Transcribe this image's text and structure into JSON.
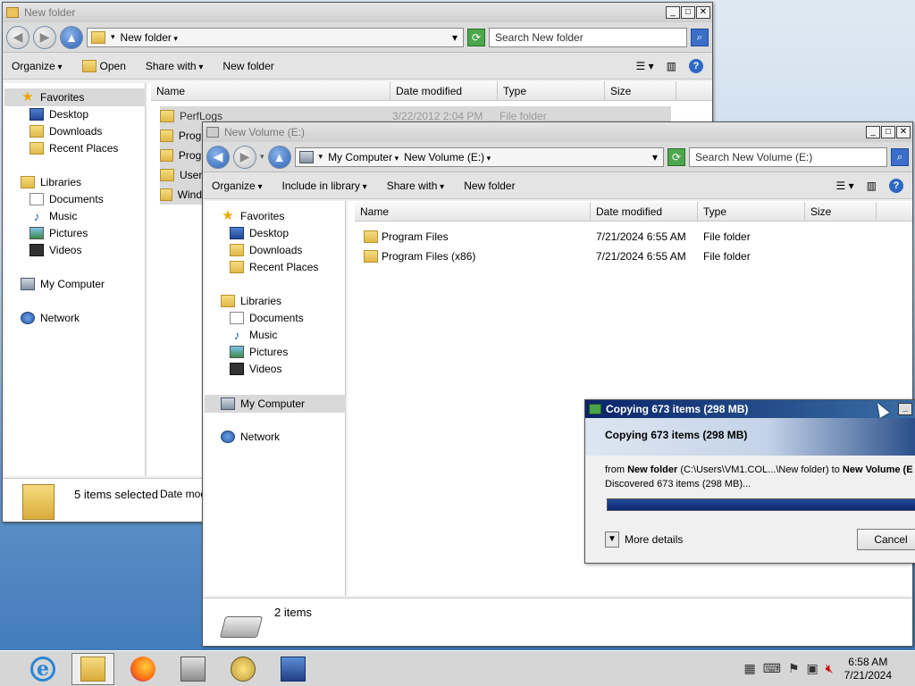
{
  "back_window": {
    "title": "New folder",
    "address": [
      "New folder"
    ],
    "search_placeholder": "Search New folder",
    "toolbar": {
      "organize": "Organize",
      "open": "Open",
      "share_with": "Share with",
      "new_folder": "New folder"
    },
    "nav": {
      "favorites": "Favorites",
      "desktop": "Desktop",
      "downloads": "Downloads",
      "recent": "Recent Places",
      "libraries": "Libraries",
      "documents": "Documents",
      "music": "Music",
      "pictures": "Pictures",
      "videos": "Videos",
      "computer": "My Computer",
      "network": "Network"
    },
    "columns": {
      "name": "Name",
      "date": "Date modified",
      "type": "Type",
      "size": "Size"
    },
    "rows": [
      {
        "name": "PerfLogs",
        "date": "3/22/2012 2:04 PM",
        "type": "File folder"
      },
      {
        "name": "Progr"
      },
      {
        "name": "Progr"
      },
      {
        "name": "User"
      },
      {
        "name": "Windo"
      }
    ],
    "status": {
      "selected": "5 items selected",
      "date": "Date mod"
    }
  },
  "front_window": {
    "title": "New Volume (E:)",
    "address": [
      "My Computer",
      "New Volume (E:)"
    ],
    "search_placeholder": "Search New Volume (E:)",
    "toolbar": {
      "organize": "Organize",
      "include": "Include in library",
      "share_with": "Share with",
      "new_folder": "New folder"
    },
    "nav": {
      "favorites": "Favorites",
      "desktop": "Desktop",
      "downloads": "Downloads",
      "recent": "Recent Places",
      "libraries": "Libraries",
      "documents": "Documents",
      "music": "Music",
      "pictures": "Pictures",
      "videos": "Videos",
      "computer": "My Computer",
      "network": "Network"
    },
    "columns": {
      "name": "Name",
      "date": "Date modified",
      "type": "Type",
      "size": "Size"
    },
    "rows": [
      {
        "name": "Program Files",
        "date": "7/21/2024 6:55 AM",
        "type": "File folder"
      },
      {
        "name": "Program Files (x86)",
        "date": "7/21/2024 6:55 AM",
        "type": "File folder"
      }
    ],
    "status": {
      "count": "2 items"
    }
  },
  "copy_dialog": {
    "title": "Copying 673 items (298 MB)",
    "heading": "Copying 673 items (298 MB)",
    "from_prefix": "from ",
    "from_name": "New folder",
    "from_path": " (C:\\Users\\VM1.COL...\\New folder) to ",
    "to_name": "New Volume (E",
    "discovered": "Discovered 673 items (298 MB)...",
    "progress": 1.0,
    "more_details": "More details",
    "cancel": "Cancel"
  },
  "taskbar": {
    "clock_time": "6:58 AM",
    "clock_date": "7/21/2024"
  }
}
